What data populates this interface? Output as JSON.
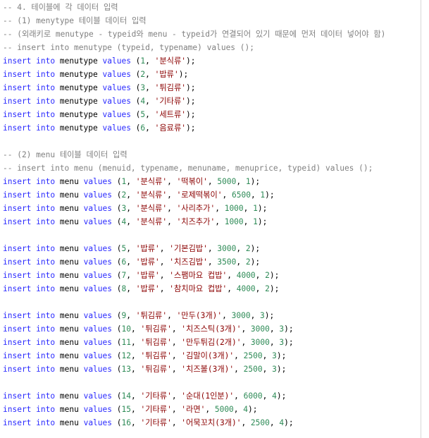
{
  "editor": {
    "lines": [
      "-- 4. 테이블에 각 데이터 입력",
      "-- (1) menytype 테이블 데이터 입력",
      "-- (외래키로 menutype - typeid와 menu - typeid가 연결되어 있기 때문에 먼저 데이터 넣어야 함)",
      "-- insert into menutype (typeid, typename) values ();",
      "insert into menutype values (1, '분식류');",
      "insert into menutype values (2, '밥류');",
      "insert into menutype values (3, '튀김류');",
      "insert into menutype values (4, '기타류');",
      "insert into menutype values (5, '세트류');",
      "insert into menutype values (6, '음료류');",
      "",
      "-- (2) menu 테이블 데이터 입력",
      "-- insert into menu (menuid, typename, menuname, menuprice, typeid) values ();",
      "insert into menu values (1, '분식류', '떡볶이', 5000, 1);",
      "insert into menu values (2, '분식류', '로제떡볶이', 6500, 1);",
      "insert into menu values (3, '분식류', '사리추가', 1000, 1);",
      "insert into menu values (4, '분식류', '치즈추가', 1000, 1);",
      "",
      "insert into menu values (5, '밥류', '기본김밥', 3000, 2);",
      "insert into menu values (6, '밥류', '치즈김밥', 3500, 2);",
      "insert into menu values (7, '밥류', '스팸마요 컵밥', 4000, 2);",
      "insert into menu values (8, '밥류', '참치마요 컵밥', 4000, 2);",
      "",
      "insert into menu values (9, '튀김류', '만두(3개)', 3000, 3);",
      "insert into menu values (10, '튀김류', '치즈스틱(3개)', 3000, 3);",
      "insert into menu values (11, '튀김류', '만두튀김(2개)', 3000, 3);",
      "insert into menu values (12, '튀김류', '김말이(3개)', 2500, 3);",
      "insert into menu values (13, '튀김류', '치즈볼(3개)', 2500, 3);",
      "",
      "insert into menu values (14, '기타류', '순대(1인분)', 6000, 4);",
      "insert into menu values (15, '기타류', '라면', 5000, 4);",
      "insert into menu values (16, '기타류', '어묵꼬치(3개)', 2500, 4);"
    ]
  },
  "colors": {
    "comment": "#808080",
    "keyword": "#2a2aff",
    "string": "#8b0000",
    "number": "#2e8b57",
    "background": "#ffffff"
  }
}
